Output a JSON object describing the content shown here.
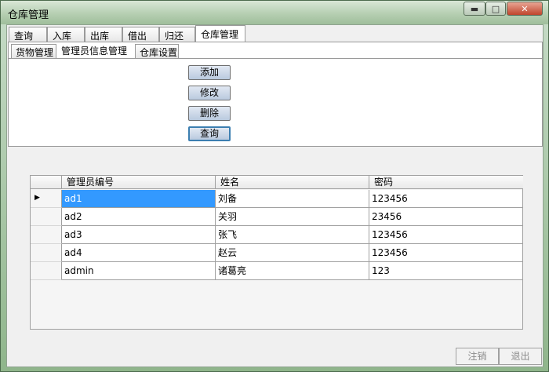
{
  "window": {
    "title": "仓库管理"
  },
  "main_tabs": [
    "查询",
    "入库",
    "出库",
    "借出",
    "归还",
    "仓库管理"
  ],
  "sub_tabs": [
    "货物管理",
    "管理员信息管理",
    "仓库设置"
  ],
  "actions": {
    "add": "添加",
    "modify": "修改",
    "delete": "删除",
    "query": "查询"
  },
  "grid": {
    "columns": [
      "管理员编号",
      "姓名",
      "密码"
    ],
    "rows": [
      [
        "ad1",
        "刘备",
        "123456"
      ],
      [
        "ad2",
        "关羽",
        "23456"
      ],
      [
        "ad3",
        "张飞",
        "123456"
      ],
      [
        "ad4",
        "赵云",
        "123456"
      ],
      [
        "admin",
        "诸葛亮",
        "123"
      ]
    ],
    "current_row_marker": "▶"
  },
  "footer": {
    "logout": "注销",
    "exit": "退出"
  }
}
